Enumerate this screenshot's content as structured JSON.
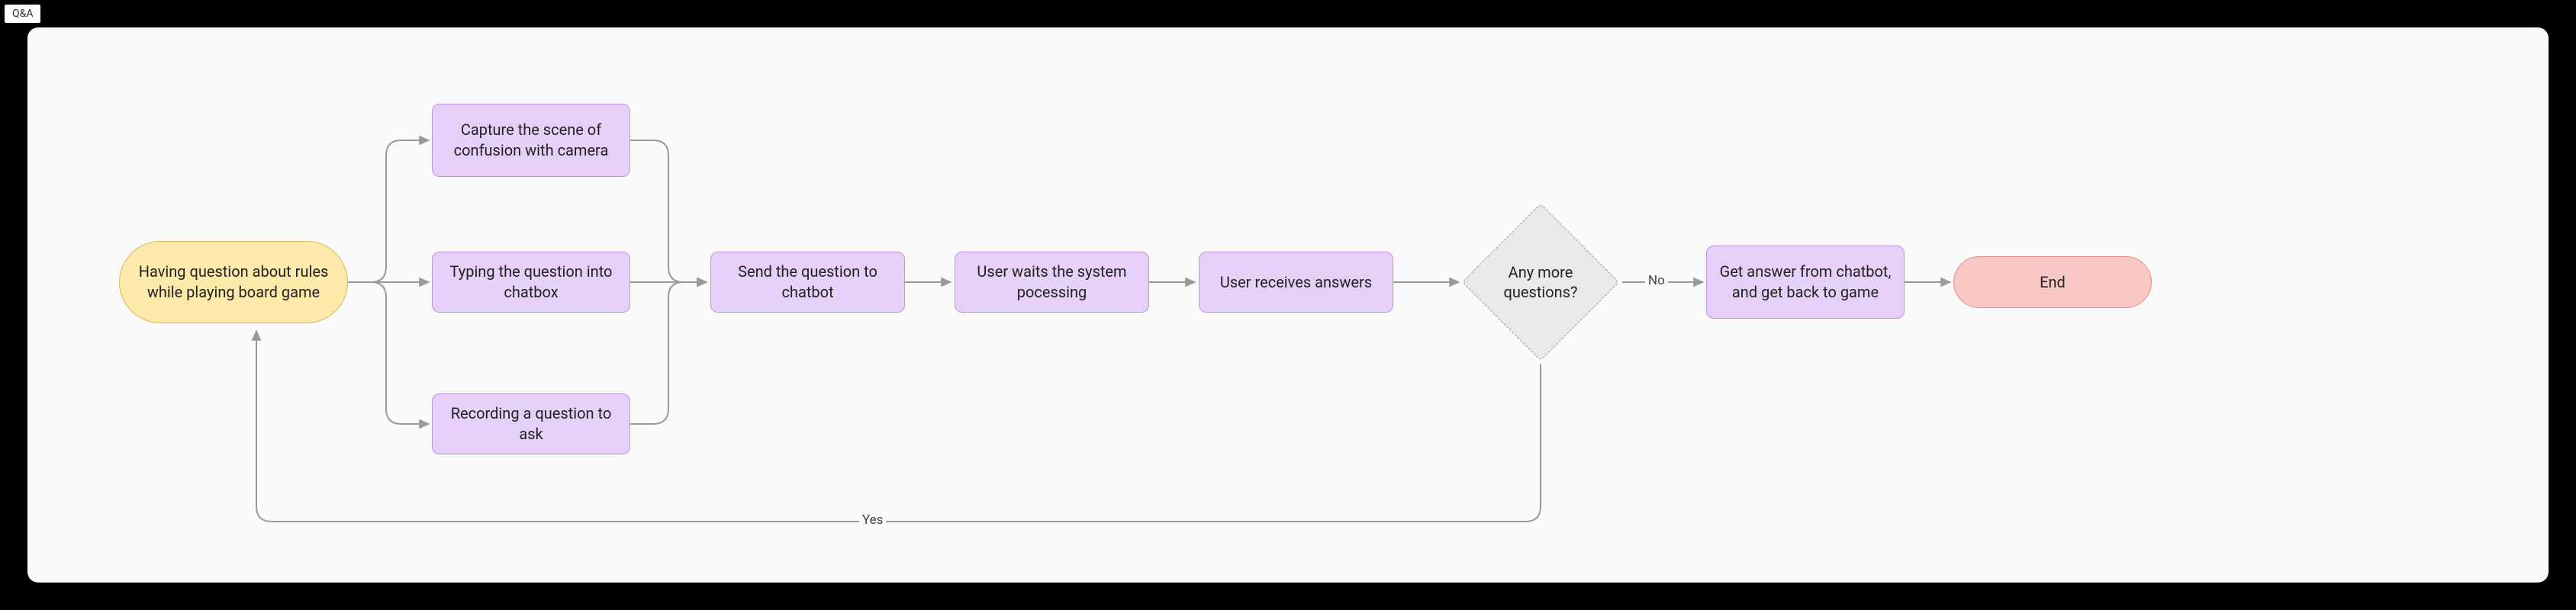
{
  "tab": "Q&A",
  "nodes": {
    "start": "Having question about rules while playing board game",
    "capture": "Capture the scene of confusion with camera",
    "typing": "Typing the question into chatbox",
    "recording": "Recording a question to ask",
    "send": "Send the question to chatbot",
    "wait": "User waits the system pocessing",
    "receive": "User receives answers",
    "decision": "Any more questions?",
    "getback": "Get answer from chatbot, and get back to game",
    "end": "End"
  },
  "edges": {
    "no": "No",
    "yes": "Yes"
  }
}
